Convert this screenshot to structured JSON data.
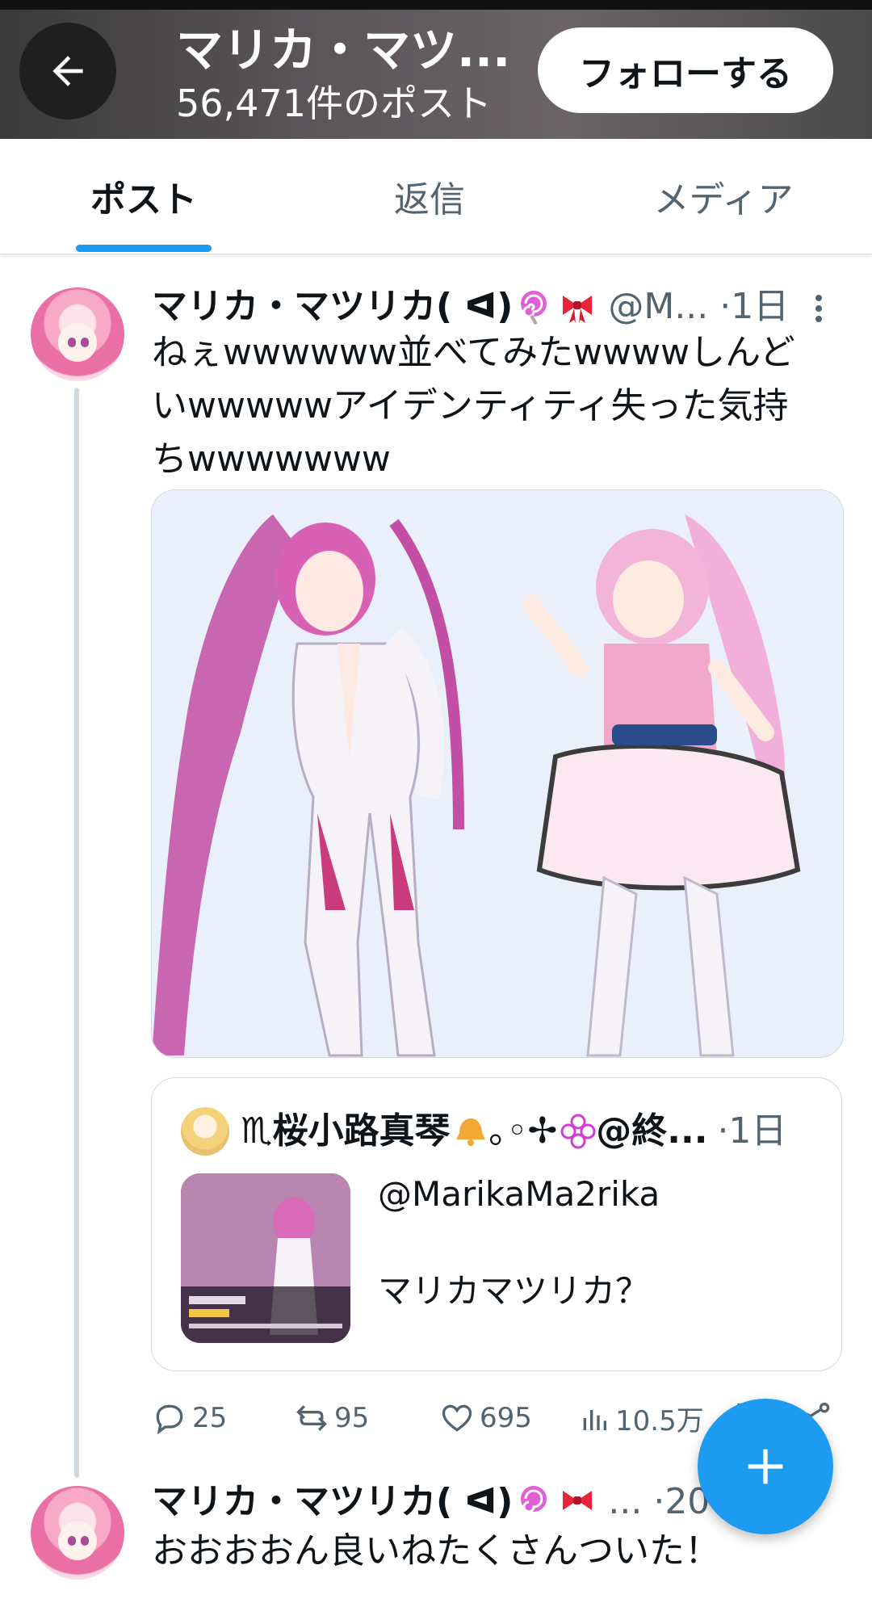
{
  "header": {
    "title": "マリカ・マツ...",
    "post_count": "56,471件のポスト",
    "follow_label": "フォローする",
    "back_icon": "arrow-left-icon"
  },
  "tabs": [
    {
      "label": "ポスト",
      "active": true
    },
    {
      "label": "返信",
      "active": false
    },
    {
      "label": "メディア",
      "active": false
    }
  ],
  "post": {
    "display_name": "マリカ・マツリカ( ᐊ)",
    "handle": "@M...",
    "time": "·1日",
    "text": "ねぇwwwwww並べてみたwwwwしんどいwwwwwアイデンティティ失った気持ちwwwwwww",
    "quote": {
      "display_name": "♏︎桜小路真琴",
      "name_suffix": "｡◦✢",
      "handle": "@終...",
      "time": "·1日",
      "text": "@MarikaMa2rika\n\nマリカマツリカ？"
    },
    "actions": {
      "replies": "25",
      "reposts": "95",
      "likes": "695",
      "views": "10.5万"
    }
  },
  "second_post": {
    "display_name": "マリカ・マツリカ( ᐊ)",
    "handle": "...",
    "time": "·20",
    "text": "おおおおん良いねたくさんついた！"
  },
  "colors": {
    "accent": "#1d9bf0",
    "text_primary": "#0f1419",
    "text_secondary": "#536471"
  }
}
